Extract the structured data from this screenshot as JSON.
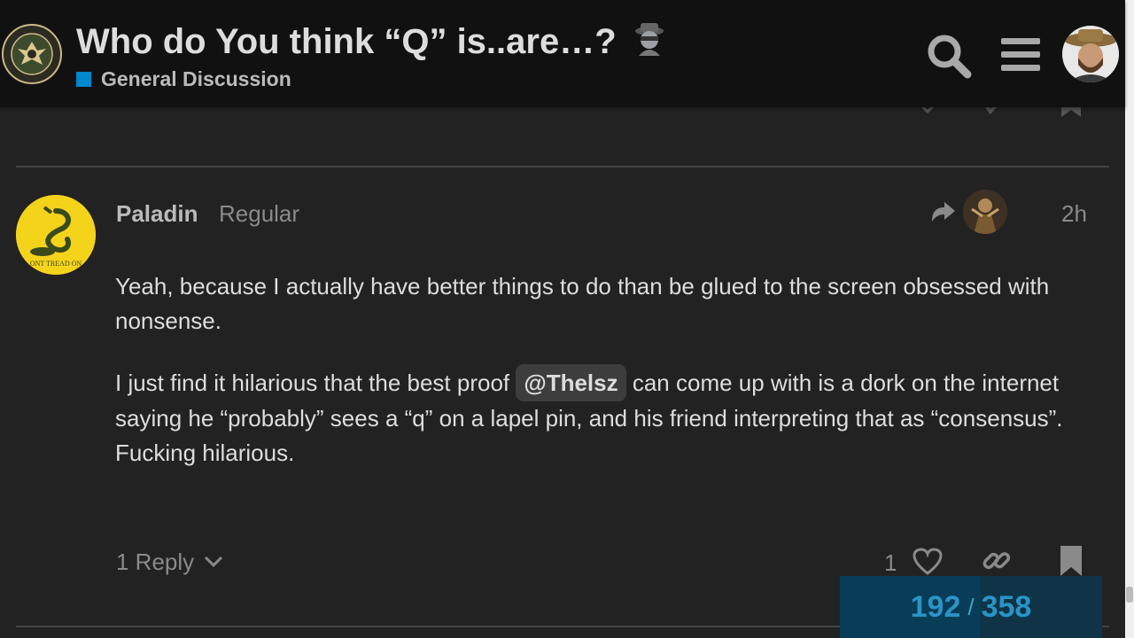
{
  "header": {
    "topic_title": "Who do You think “Q” is..are…?",
    "title_emoji": "detective-emoji",
    "category": {
      "name": "General Discussion",
      "color": "#0088cc"
    },
    "icons": [
      "search-icon",
      "hamburger-menu-icon",
      "user-avatar"
    ]
  },
  "post": {
    "username": "Paladin",
    "user_title": "Regular",
    "date": "2h",
    "avatar": "gadsden-flag-avatar",
    "avatar_text": "ONT TREAD ON",
    "paragraphs": [
      {
        "text": "Yeah, because I actually have better things to do than be glued to the screen obsessed with nonsense."
      },
      {
        "before": "I just find it hilarious that the best proof ",
        "mention": "@Thelsz",
        "after": " can come up with is a dork on the internet saying he “probably” sees a “q” on a lapel pin, and his friend interpreting that as “consensus”. Fucking hilarious."
      }
    ],
    "controls": {
      "replies_label": "1 Reply",
      "like_count": "1",
      "icons": [
        "chevron-down-icon",
        "heart-icon",
        "link-icon",
        "bookmark-icon"
      ]
    }
  },
  "timeline": {
    "current": "192",
    "separator": "/",
    "total": "358",
    "fraction": 0.536
  },
  "colors": {
    "background": "#222222",
    "header": "#111111",
    "accent": "#0088cc",
    "text": "#dddddd",
    "muted": "#8a8a8a"
  }
}
